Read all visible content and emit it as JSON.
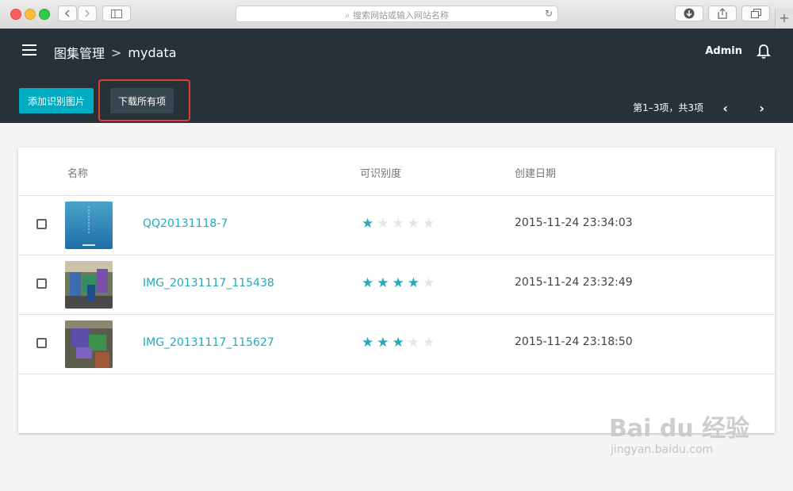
{
  "browser": {
    "address_placeholder": "搜索网站或输入网站名称",
    "new_tab_symbol": "+"
  },
  "header": {
    "breadcrumb_root": "图集管理",
    "breadcrumb_sep": ">",
    "breadcrumb_current": "mydata",
    "user": "Admin"
  },
  "toolbar": {
    "add_label": "添加识别图片",
    "download_label": "下载所有项",
    "paging_text": "第1–3项，共3项",
    "prev": "‹",
    "next": "›"
  },
  "table": {
    "columns": [
      "名称",
      "可识别度",
      "创建日期"
    ],
    "rows": [
      {
        "name": "QQ20131118-7",
        "rating": 1,
        "date": "2015-11-24 23:34:03"
      },
      {
        "name": "IMG_20131117_115438",
        "rating": 4,
        "date": "2015-11-24 23:32:49"
      },
      {
        "name": "IMG_20131117_115627",
        "rating": 3,
        "date": "2015-11-24 23:18:50"
      }
    ],
    "max_rating": 5
  },
  "colors": {
    "accent": "#00acc1",
    "header_bg": "#263238",
    "highlight_border": "#e53935",
    "star_on": "#26a9b8",
    "star_off": "#e5e5e5"
  },
  "watermark": {
    "brand": "Bai du 经验",
    "url": "jingyan.baidu.com"
  }
}
